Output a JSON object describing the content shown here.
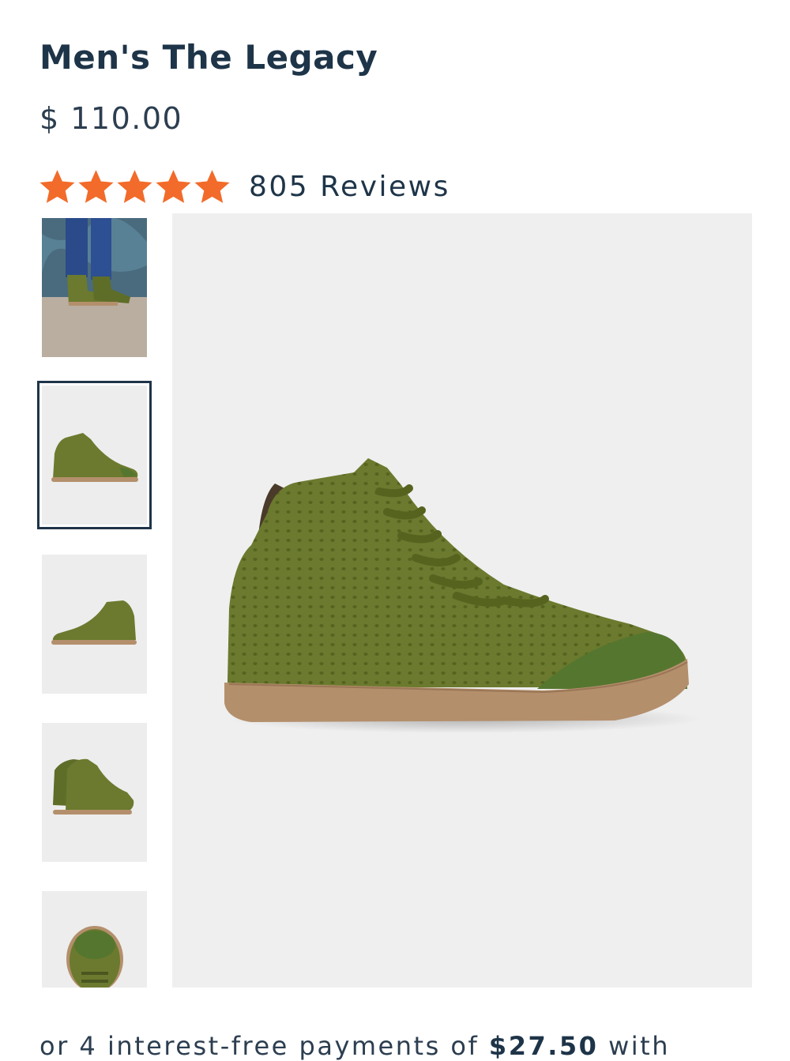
{
  "product": {
    "title": "Men's The Legacy",
    "price": "$ 110.00",
    "rating": {
      "stars": 5,
      "reviews_label": "805 Reviews",
      "star_color": "#f26b2a"
    }
  },
  "gallery": {
    "thumbnails": [
      {
        "icon": "lifestyle-photo",
        "selected": false
      },
      {
        "icon": "shoe-side-photo",
        "selected": true
      },
      {
        "icon": "shoe-side-photo",
        "selected": false
      },
      {
        "icon": "shoe-pair-photo",
        "selected": false
      },
      {
        "icon": "shoe-top-photo",
        "selected": false
      }
    ],
    "main_icon": "shoe-side-photo"
  },
  "payments": {
    "prefix": "or 4 interest-free payments of ",
    "amount": "$27.50",
    "suffix": " with"
  },
  "colors": {
    "heading": "#1e3448",
    "shoe_green": "#6b7a2e",
    "sole_tan": "#b48f6c",
    "image_bg": "#efefef"
  }
}
